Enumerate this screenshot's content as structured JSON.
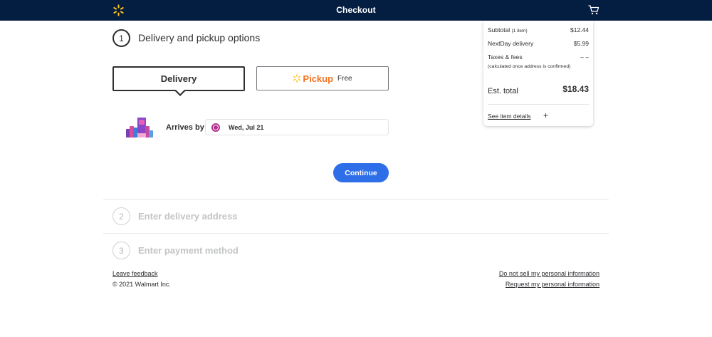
{
  "header": {
    "title": "Checkout",
    "logo_icon": "walmart-spark-icon",
    "cart_icon": "cart-icon",
    "bg_color": "#041e42",
    "spark_color": "#ffc220"
  },
  "step1": {
    "number": "1",
    "title": "Delivery and pickup options"
  },
  "options": {
    "delivery_label": "Delivery",
    "pickup_label": "Pickup",
    "pickup_price": "Free",
    "pickup_color": "#f47321"
  },
  "arrival": {
    "label": "Arrives by",
    "date": "Wed, Jul 21",
    "radio_color": "#b32d8e"
  },
  "continue_label": "Continue",
  "continue_color": "#2e6ee8",
  "step2": {
    "number": "2",
    "title": "Enter delivery address"
  },
  "step3": {
    "number": "3",
    "title": "Enter payment method"
  },
  "footer": {
    "feedback": "Leave feedback",
    "copyright": "© 2021 Walmart Inc.",
    "do_not_sell": "Do not sell my personal information",
    "request_info": "Request my personal information"
  },
  "summary": {
    "subtotal_label": "Subtotal",
    "subtotal_count": "(1 item)",
    "subtotal_value": "$12.44",
    "delivery_label": "NextDay delivery",
    "delivery_value": "$5.99",
    "taxes_label": "Taxes & fees",
    "taxes_value": "– –",
    "taxes_note": "(calculated once address is confirmed)",
    "total_label": "Est. total",
    "total_value": "$18.43",
    "details_link": "See item details",
    "expand_symbol": "+"
  }
}
